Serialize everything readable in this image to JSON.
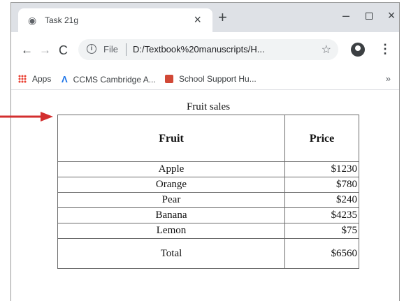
{
  "tab": {
    "title": "Task 21g",
    "close": "×"
  },
  "new_tab": "+",
  "window_controls": {
    "minimize": "–",
    "close": "×"
  },
  "toolbar": {
    "back": "←",
    "forward": "→",
    "reload": "C",
    "scheme": "File",
    "url": "D:/Textbook%20manuscripts/H...",
    "star": "☆",
    "menu": "⋮"
  },
  "bookmarks": {
    "items": [
      {
        "label": "Apps"
      },
      {
        "label": "CCMS Cambridge A..."
      },
      {
        "label": "School Support Hu..."
      }
    ],
    "more": "»"
  },
  "page": {
    "caption": "Fruit sales",
    "headers": {
      "fruit": "Fruit",
      "price": "Price"
    },
    "rows": [
      {
        "fruit": "Apple",
        "price": "$1230"
      },
      {
        "fruit": "Orange",
        "price": "$780"
      },
      {
        "fruit": "Pear",
        "price": "$240"
      },
      {
        "fruit": "Banana",
        "price": "$4235"
      },
      {
        "fruit": "Lemon",
        "price": "$75"
      }
    ],
    "total": {
      "label": "Total",
      "price": "$6560"
    }
  },
  "annotation": {
    "arrow_color": "#d32f2f"
  }
}
